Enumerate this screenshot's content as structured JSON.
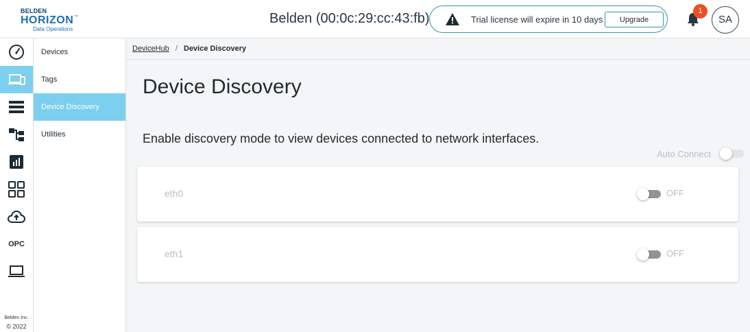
{
  "brand": {
    "top": "BELDEN",
    "main": "HORIZON",
    "tm": "™",
    "sub": "Data Operations"
  },
  "header": {
    "site_title": "Belden (00:0c:29:cc:43:fb)",
    "trial_message": "Trial license will expire in 10 days",
    "upgrade_label": "Upgrade",
    "notification_count": "1",
    "avatar_initials": "SA"
  },
  "rail": {
    "items": [
      {
        "icon": "dashboard-gauge-icon",
        "active": false
      },
      {
        "icon": "devices-icon",
        "active": true
      },
      {
        "icon": "list-icon",
        "active": false
      },
      {
        "icon": "hierarchy-icon",
        "active": false
      },
      {
        "icon": "bar-chart-icon",
        "active": false
      },
      {
        "icon": "apps-grid-icon",
        "active": false
      },
      {
        "icon": "cloud-upload-icon",
        "active": false
      },
      {
        "icon": "opc-icon",
        "label": "OPC",
        "active": false
      },
      {
        "icon": "laptop-icon",
        "active": false
      }
    ],
    "footer_company": "Belden Inc.",
    "footer_copyright": "© 2022"
  },
  "submenu": {
    "items": [
      {
        "label": "Devices",
        "active": false
      },
      {
        "label": "Tags",
        "active": false
      },
      {
        "label": "Device Discovery",
        "active": true
      },
      {
        "label": "Utilities",
        "active": false
      }
    ]
  },
  "breadcrumb": {
    "parent": "DeviceHub",
    "separator": "/",
    "current": "Device Discovery"
  },
  "main": {
    "title": "Device Discovery",
    "intro": "Enable discovery mode to view devices connected to network interfaces.",
    "auto_connect_label": "Auto Connect",
    "auto_connect_on": false,
    "interfaces": [
      {
        "name": "eth0",
        "state": "OFF"
      },
      {
        "name": "eth1",
        "state": "OFF"
      }
    ]
  },
  "colors": {
    "accent": "#7ccfee",
    "banner_border": "#2f97a8",
    "badge": "#f04e23",
    "brand_blue": "#1a6fb4"
  }
}
